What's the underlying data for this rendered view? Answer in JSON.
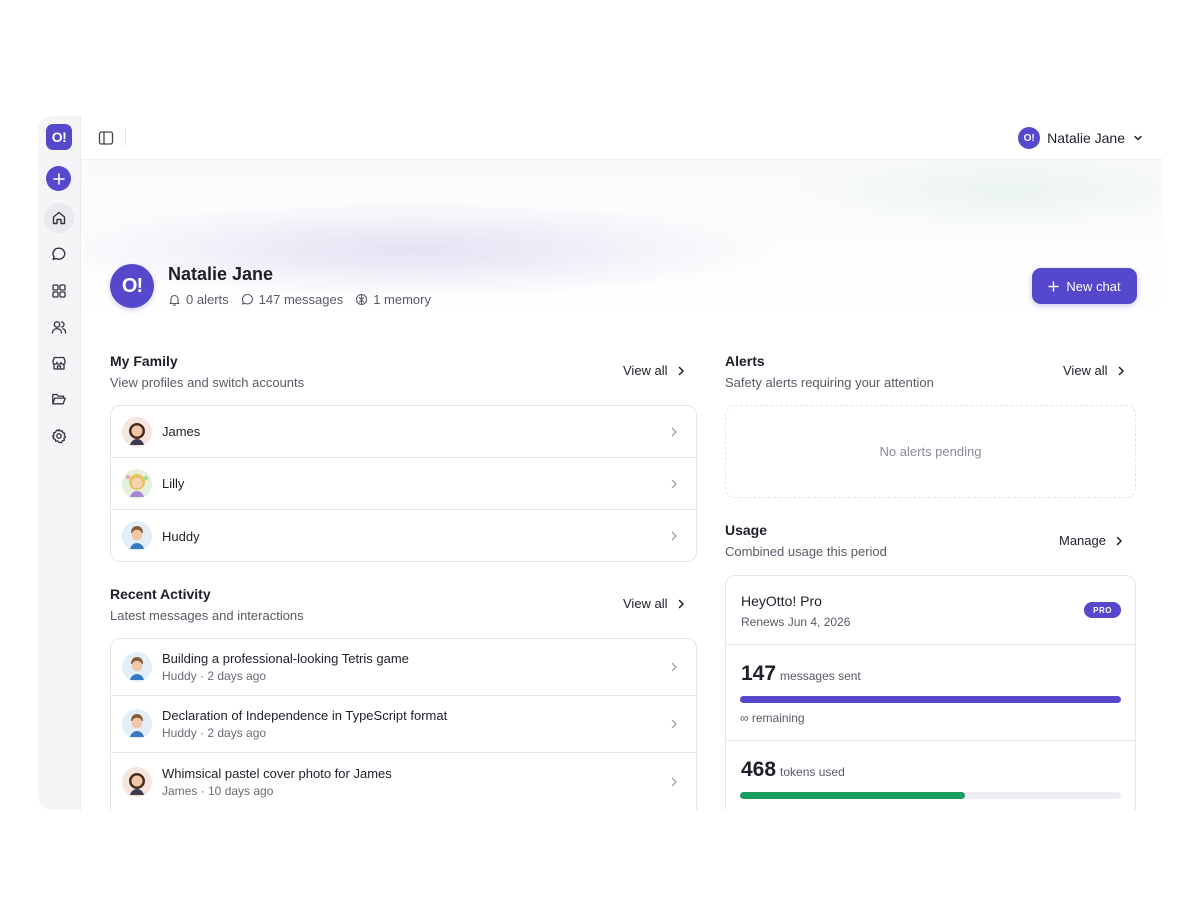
{
  "brand": {
    "logo_text": "O!",
    "accent": "#5548cc",
    "success": "#1a9e5f"
  },
  "rail": {
    "new_icon": "plus-icon",
    "items": [
      {
        "name": "home-icon",
        "active": true
      },
      {
        "name": "chat-bubble-icon",
        "active": false
      },
      {
        "name": "grid-icon",
        "active": false
      },
      {
        "name": "users-icon",
        "active": false
      },
      {
        "name": "store-icon",
        "active": false
      },
      {
        "name": "folder-icon",
        "active": false
      },
      {
        "name": "gear-icon",
        "active": false
      }
    ]
  },
  "topbar": {
    "user_name": "Natalie Jane",
    "avatar_text": "O!"
  },
  "profile": {
    "avatar_text": "O!",
    "name": "Natalie Jane",
    "alerts": "0 alerts",
    "messages": "147 messages",
    "memory": "1 memory",
    "new_chat_label": "New chat"
  },
  "family": {
    "title": "My Family",
    "subtitle": "View profiles and switch accounts",
    "view_all": "View all",
    "members": [
      {
        "name": "James",
        "avatar": "girl-avatar"
      },
      {
        "name": "Lilly",
        "avatar": "girl-blonde-avatar"
      },
      {
        "name": "Huddy",
        "avatar": "boy-avatar"
      }
    ]
  },
  "activity": {
    "title": "Recent Activity",
    "subtitle": "Latest messages and interactions",
    "view_all": "View all",
    "items": [
      {
        "title": "Building a professional-looking Tetris game",
        "meta": "Huddy · 2 days ago",
        "avatar": "boy-avatar"
      },
      {
        "title": "Declaration of Independence in TypeScript format",
        "meta": "Huddy · 2 days ago",
        "avatar": "boy-avatar"
      },
      {
        "title": "Whimsical pastel cover photo for James",
        "meta": "James · 10 days ago",
        "avatar": "girl-avatar"
      }
    ]
  },
  "alerts": {
    "title": "Alerts",
    "subtitle": "Safety alerts requiring your attention",
    "view_all": "View all",
    "empty_text": "No alerts pending"
  },
  "usage": {
    "title": "Usage",
    "subtitle": "Combined usage this period",
    "manage": "Manage",
    "plan_name": "HeyOtto! Pro",
    "renews": "Renews Jun 4, 2026",
    "badge": "PRO",
    "messages_count": "147",
    "messages_unit": "messages sent",
    "messages_fraction": 1.0,
    "remaining": "∞ remaining",
    "tokens_count": "468",
    "tokens_unit": "tokens used",
    "tokens_fraction": 0.59
  }
}
